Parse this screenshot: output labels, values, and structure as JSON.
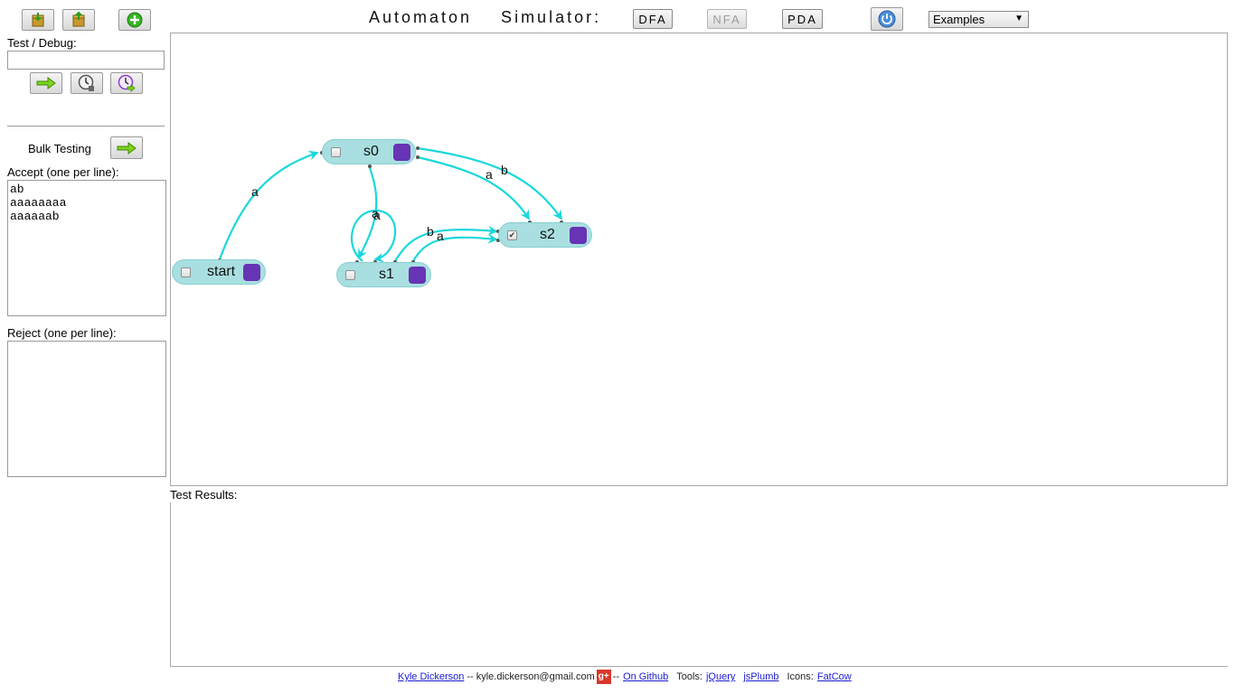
{
  "header": {
    "title": "Automaton    Simulator:",
    "modes": [
      {
        "label": "DFA",
        "state": "enabled"
      },
      {
        "label": "NFA",
        "state": "disabled"
      },
      {
        "label": "PDA",
        "state": "enabled"
      }
    ],
    "examples_select": {
      "selected": "Examples",
      "icon": "dropdown-arrow"
    }
  },
  "toolbar": {
    "icons": [
      "save-icon",
      "load-icon",
      "add-state-icon",
      "reset-icon"
    ]
  },
  "debug": {
    "label": "Test / Debug:",
    "input_value": "",
    "buttons": [
      "run-arrow-icon",
      "step-clock-icon",
      "step-forward-clock-icon"
    ]
  },
  "bulk": {
    "label": "Bulk Testing",
    "accept_label": "Accept (one per line):",
    "accept_text": "ab\naaaaaaaa\naaaaaab",
    "reject_label": "Reject (one per line):",
    "reject_text": ""
  },
  "results": {
    "label": "Test Results:"
  },
  "automaton": {
    "states": [
      {
        "id": "start",
        "name": "start",
        "accepting": false
      },
      {
        "id": "s0",
        "name": "s0",
        "accepting": false
      },
      {
        "id": "s1",
        "name": "s1",
        "accepting": false
      },
      {
        "id": "s2",
        "name": "s2",
        "accepting": true
      }
    ],
    "transitions": [
      {
        "from": "start",
        "to": "s0",
        "symbol": "a"
      },
      {
        "from": "s0",
        "to": "s2",
        "symbol": "a"
      },
      {
        "from": "s0",
        "to": "s2",
        "symbol": "b"
      },
      {
        "from": "s0",
        "to": "s1",
        "symbol": "a"
      },
      {
        "from": "s1",
        "to": "s1",
        "symbol": "a"
      },
      {
        "from": "s1",
        "to": "s2",
        "symbol": "b"
      },
      {
        "from": "s1",
        "to": "s2",
        "symbol": "a"
      }
    ],
    "edge_color": "#1ad8dc"
  },
  "footer": {
    "author": "Kyle Dickerson",
    "sep1": "-- kyle.dickerson@gmail.com",
    "gplus": "g+",
    "sep2": "--",
    "github": "On Github",
    "tools_label": "Tools:",
    "tool1": "jQuery",
    "tool2": "jsPlumb",
    "icons_label": "Icons:",
    "icons_credit": "FatCow"
  }
}
